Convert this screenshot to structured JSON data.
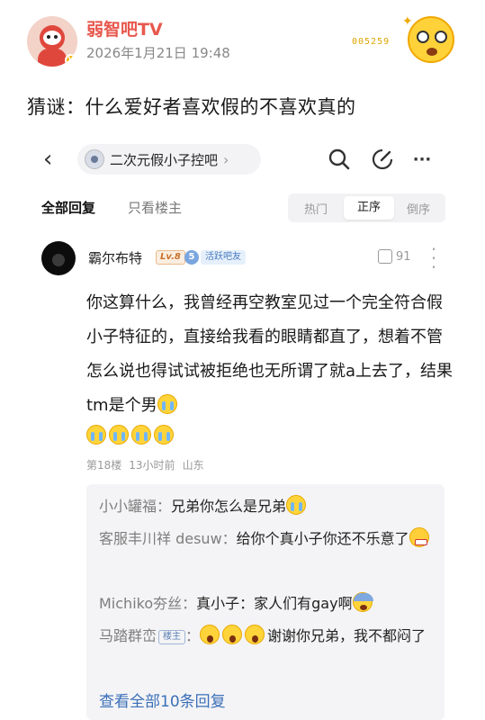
{
  "post": {
    "account_name": "弱智吧TV",
    "date": "2026年1月21日 19:48",
    "sticker_caption": "005259",
    "riddle": "猜谜：什么爱好者喜欢假的不喜欢真的"
  },
  "topbar": {
    "back_icon": "‹",
    "forum_name": "二次元假小子控吧",
    "forum_chevron": "›",
    "more_icon": "···"
  },
  "tabs": {
    "all_replies": "全部回复",
    "op_only": "只看楼主",
    "sort_hot": "热门",
    "sort_asc": "正序",
    "sort_desc": "倒序"
  },
  "comment": {
    "username": "霸尔布特",
    "level": "Lv.8",
    "fan_level": "5",
    "fan_label": "活跃吧友",
    "likes": "91",
    "body": "你这算什么，我曾经再空教室见过一个完全符合假小子特征的，直接给我看的眼睛都直了，想着不管怎么说也得试试被拒绝也无所谓了就a上去了，结果tm是个男",
    "floor": "第18楼",
    "time": "13小时前",
    "location": "山东"
  },
  "replies": [
    {
      "who": "小小罐福",
      "sep": "：",
      "text": "兄弟你怎么是兄弟"
    },
    {
      "who": "客服丰川祥 desuw",
      "sep": "：",
      "text": "给你个真小子你还不乐意了"
    },
    {
      "who": "Michiko夯丝",
      "sep": "：",
      "text": "真小子：家人们有gay啊"
    },
    {
      "who": "马踏群峦",
      "tag": "楼主",
      "sep": "：",
      "text": "谢谢你兄弟，我不都闷了"
    }
  ],
  "view_all": "查看全部10条回复",
  "colors": {
    "account_name": "#e8584e",
    "link": "#3b6fb8",
    "reply_box_bg": "#f4f4f6"
  }
}
